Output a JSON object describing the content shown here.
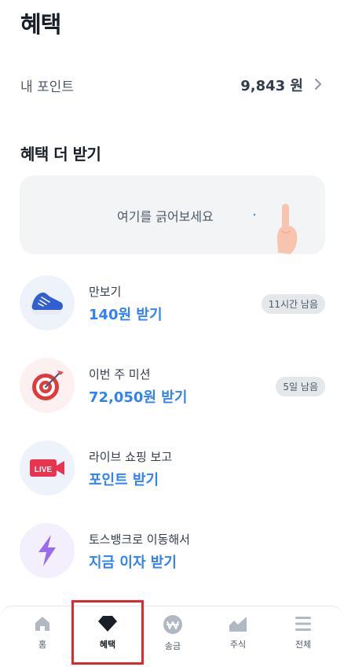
{
  "header": {
    "title": "혜택"
  },
  "points": {
    "label": "내 포인트",
    "value": "9,843 원"
  },
  "section": {
    "title": "혜택 더 받기"
  },
  "scratch": {
    "text": "여기를 긁어보세요"
  },
  "benefits": [
    {
      "subtitle": "만보기",
      "title": "140원 받기",
      "badge": "11시간 남음",
      "icon": "sneaker-icon"
    },
    {
      "subtitle": "이번 주 미션",
      "title": "72,050원 받기",
      "badge": "5일 남음",
      "icon": "dart-target-icon"
    },
    {
      "subtitle": "라이브 쇼핑 보고",
      "title": "포인트 받기",
      "badge": "",
      "icon": "live-camera-icon",
      "icon_text": "LIVE"
    },
    {
      "subtitle": "토스뱅크로 이동해서",
      "title": "지금 이자 받기",
      "badge": "",
      "icon": "lightning-icon"
    }
  ],
  "tabbar": {
    "tabs": [
      {
        "label": "홈",
        "icon": "home-icon"
      },
      {
        "label": "혜택",
        "icon": "gem-icon",
        "active": true
      },
      {
        "label": "송금",
        "icon": "won-coin-icon"
      },
      {
        "label": "주식",
        "icon": "stock-chart-icon"
      },
      {
        "label": "전체",
        "icon": "menu-icon"
      }
    ]
  },
  "colors": {
    "accent": "#3182f6",
    "highlight": "#e1282d",
    "card_bg": "#f2f4f6"
  }
}
